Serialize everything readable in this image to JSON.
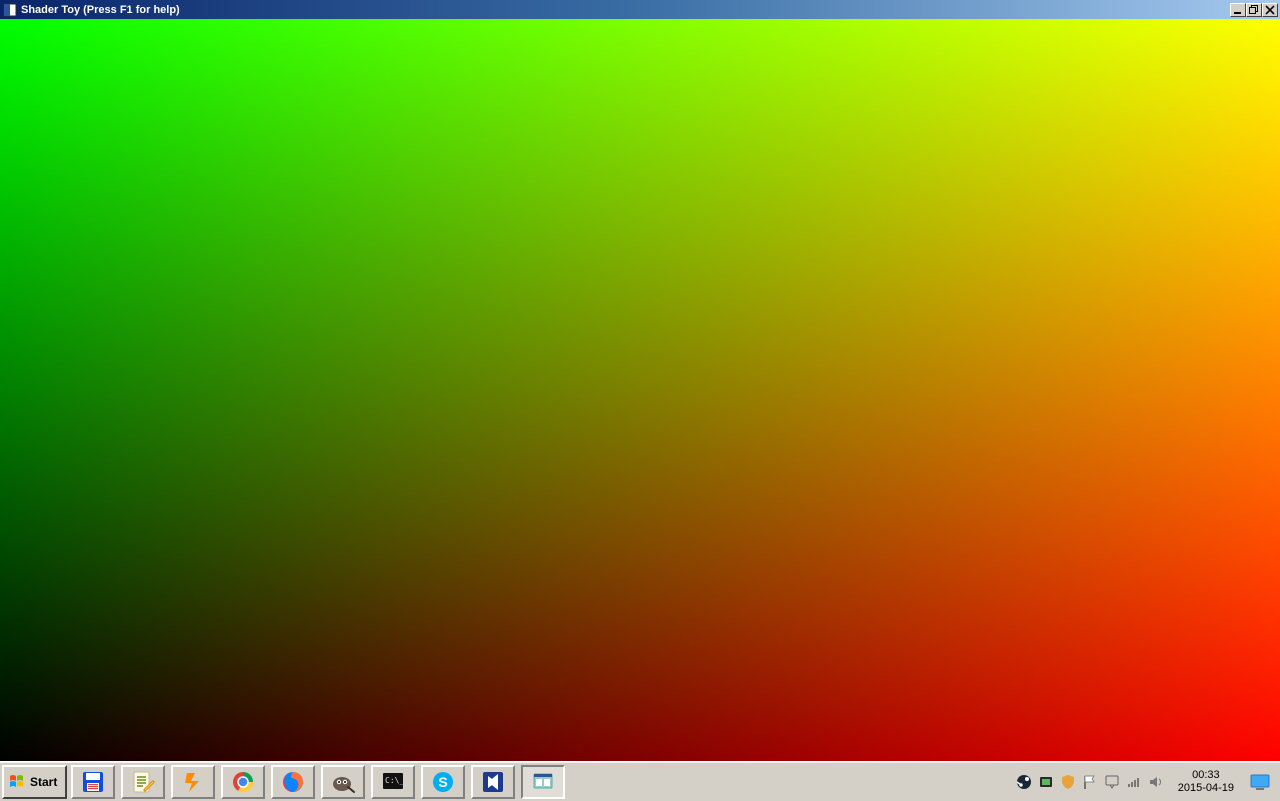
{
  "window": {
    "title": "Shader Toy (Press F1 for help)",
    "sysmenu_icon": "app-icon"
  },
  "caption": {
    "minimize_icon": "minimize-icon",
    "maximize_icon": "restore-icon",
    "close_icon": "close-icon"
  },
  "taskbar": {
    "start_label": "Start",
    "quick_launch": [
      {
        "name": "save-icon",
        "title": "Save"
      },
      {
        "name": "notepadpp-icon",
        "title": "Notepad++"
      },
      {
        "name": "winamp-icon",
        "title": "Winamp"
      },
      {
        "name": "chrome-icon",
        "title": "Google Chrome"
      },
      {
        "name": "firefox-icon",
        "title": "Firefox"
      },
      {
        "name": "gimp-icon",
        "title": "GIMP"
      },
      {
        "name": "cmd-icon",
        "title": "Command Prompt"
      },
      {
        "name": "skype-icon",
        "title": "Skype"
      },
      {
        "name": "visualstudio-icon",
        "title": "Visual Studio"
      },
      {
        "name": "shadertoy-icon",
        "title": "Shader Toy",
        "active": true
      }
    ],
    "tray_icons": [
      "steam-icon",
      "gpu-icon",
      "security-icon",
      "flag-icon",
      "action-center-icon",
      "network-icon",
      "volume-icon"
    ],
    "clock": {
      "time": "00:33",
      "date": "2015-04-19"
    },
    "show_desktop_icon": "show-desktop-icon"
  }
}
